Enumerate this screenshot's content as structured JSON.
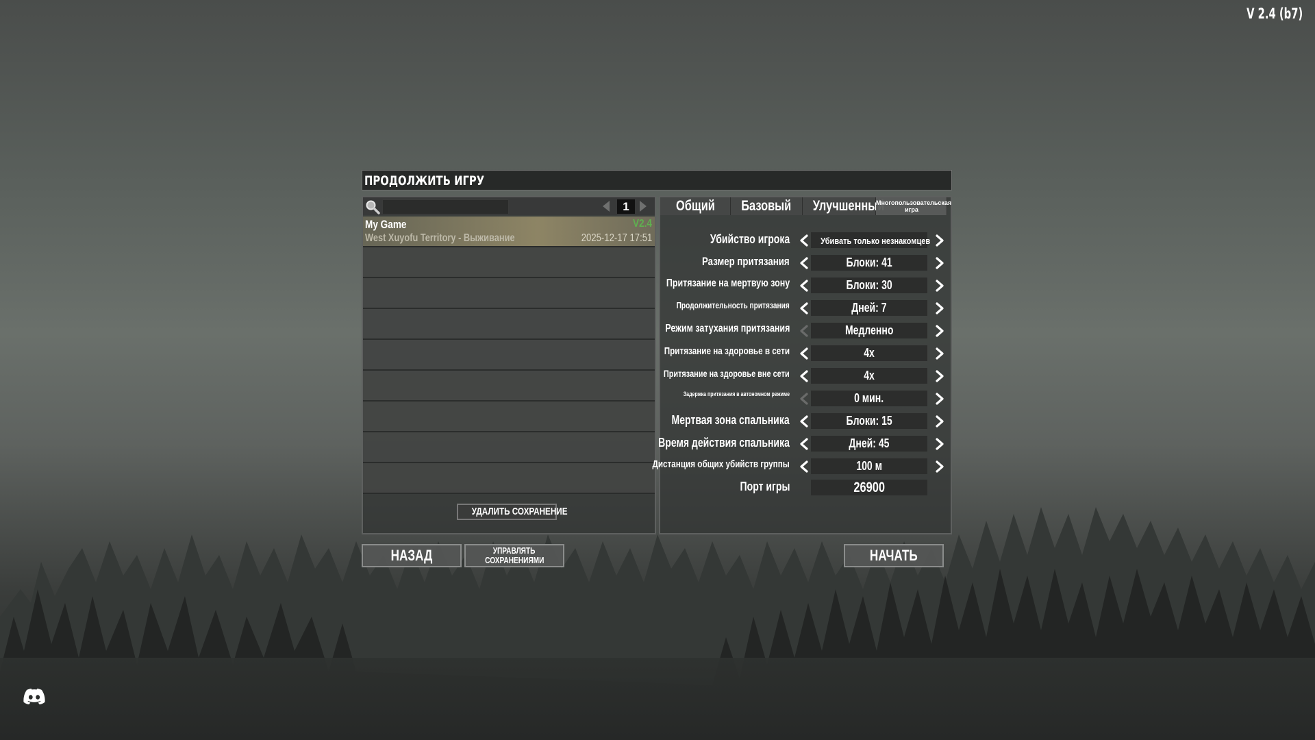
{
  "version": "V 2.4 (b7)",
  "window_title": "ПРОДОЛЖИТЬ ИГРУ",
  "search": {
    "value": "",
    "page": "1"
  },
  "saves": [
    {
      "name": "My Game",
      "version": "V2.4",
      "world": "West Xuyofu Territory - Выживание",
      "date": "2025-12-17 17:51",
      "selected": true
    }
  ],
  "empty_rows": 8,
  "delete_button": "УДАЛИТЬ СОХРАНЕНИЕ",
  "tabs": [
    {
      "label": "Общий",
      "active": false
    },
    {
      "label": "Базовый",
      "active": false
    },
    {
      "label": "Улучшенный",
      "active": false
    },
    {
      "label": "Многопользовательская игра",
      "active": true
    }
  ],
  "settings": [
    {
      "label": "Убийство игрока",
      "value": "Убивать только незнакомцев",
      "left_enabled": true,
      "right_enabled": true
    },
    {
      "label": "Размер притязания",
      "value": "Блоки: 41",
      "left_enabled": true,
      "right_enabled": true
    },
    {
      "label": "Притязание на мертвую зону",
      "value": "Блоки: 30",
      "left_enabled": true,
      "right_enabled": true
    },
    {
      "label": "Продолжительность притязания",
      "value": "Дней: 7",
      "left_enabled": true,
      "right_enabled": true
    },
    {
      "label": "Режим затухания притязания",
      "value": "Медленно",
      "left_enabled": false,
      "right_enabled": true
    },
    {
      "label": "Притязание на здоровье в сети",
      "value": "4x",
      "left_enabled": true,
      "right_enabled": true
    },
    {
      "label": "Притязание на здоровье вне сети",
      "value": "4x",
      "left_enabled": true,
      "right_enabled": true
    },
    {
      "label": "Задержка притязания в автономном режиме",
      "value": "0 мин.",
      "left_enabled": false,
      "right_enabled": true
    },
    {
      "label": "Мертвая зона спальника",
      "value": "Блоки: 15",
      "left_enabled": true,
      "right_enabled": true
    },
    {
      "label": "Время действия спальника",
      "value": "Дней: 45",
      "left_enabled": true,
      "right_enabled": true
    },
    {
      "label": "Дистанция общих убийств группы",
      "value": "100 м",
      "left_enabled": true,
      "right_enabled": true
    }
  ],
  "port": {
    "label": "Порт игры",
    "value": "26900"
  },
  "buttons": {
    "back": "НАЗАД",
    "manage_line1": "УПРАВЛЯТЬ",
    "manage_line2": "СОХРАНЕНИЯМИ",
    "start": "НАЧАТЬ"
  },
  "colors": {
    "version_green": "#5fb050",
    "selected_row": "#8f8868"
  }
}
